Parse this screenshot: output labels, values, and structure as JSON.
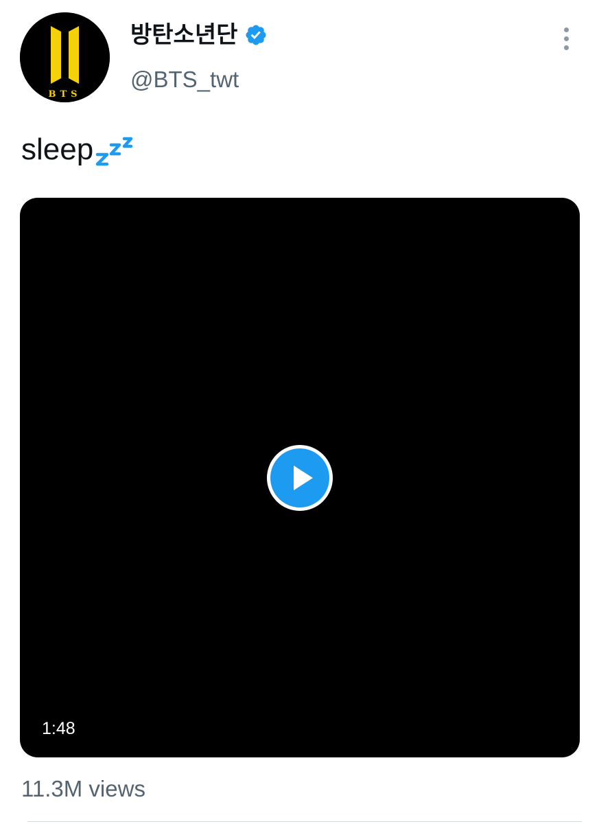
{
  "tweet": {
    "author": {
      "display_name": "방탄소년단",
      "handle": "@BTS_twt",
      "avatar_logo_text": "BTS",
      "verified": true
    },
    "text": "sleep",
    "emoji_icon": "zzz-icon",
    "video": {
      "duration": "1:48",
      "play_icon": "play-icon"
    },
    "views": "11.3M views"
  },
  "colors": {
    "accent": "#1d9bf0",
    "secondary_text": "#536471",
    "logo_yellow": "#f5d10a"
  }
}
